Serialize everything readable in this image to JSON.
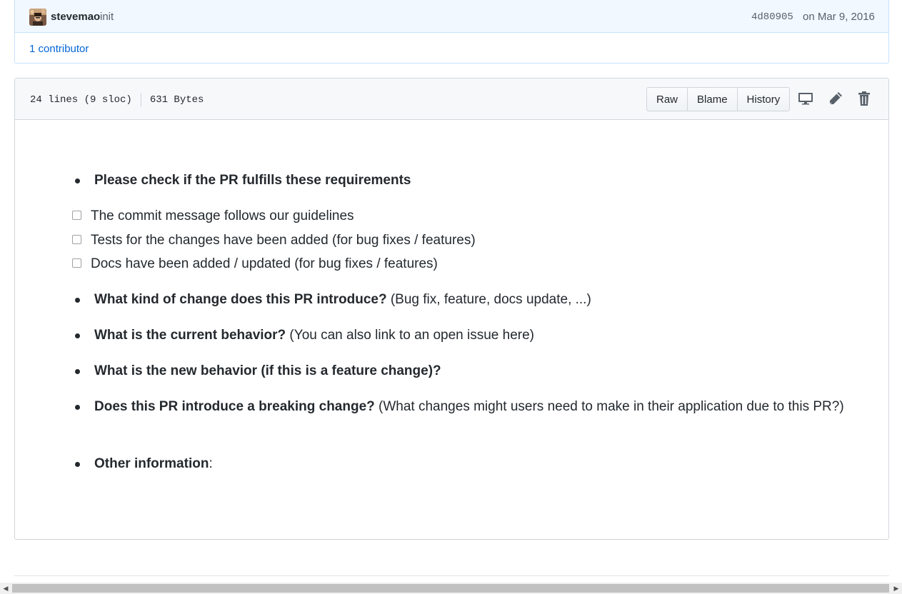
{
  "commit": {
    "author": "stevemao",
    "message": "init",
    "sha": "4d80905",
    "date": "on Mar 9, 2016",
    "contributors": "1 contributor"
  },
  "file": {
    "lines": "24 lines (9 sloc)",
    "size": "631 Bytes",
    "buttons": {
      "raw": "Raw",
      "blame": "Blame",
      "history": "History"
    },
    "icons": [
      "desktop-icon",
      "pencil-icon",
      "trash-icon"
    ]
  },
  "content": {
    "item1": {
      "bold": "Please check if the PR fulfills these requirements",
      "rest": ""
    },
    "tasks": [
      "The commit message follows our guidelines",
      "Tests for the changes have been added (for bug fixes / features)",
      "Docs have been added / updated (for bug fixes / features)"
    ],
    "item2": {
      "bold": "What kind of change does this PR introduce?",
      "rest": " (Bug fix, feature, docs update, ...)"
    },
    "item3": {
      "bold": "What is the current behavior?",
      "rest": " (You can also link to an open issue here)"
    },
    "item4": {
      "bold": "What is the new behavior (if this is a feature change)?",
      "rest": ""
    },
    "item5": {
      "bold": "Does this PR introduce a breaking change?",
      "rest": " (What changes might users need to make in their application due to this PR?)"
    },
    "item6": {
      "bold": "Other information",
      "rest": ":"
    }
  },
  "colors": {
    "link": "#0366d6",
    "commit_bg": "#f1f8ff",
    "header_bg": "#f6f8fa",
    "text": "#24292e"
  }
}
